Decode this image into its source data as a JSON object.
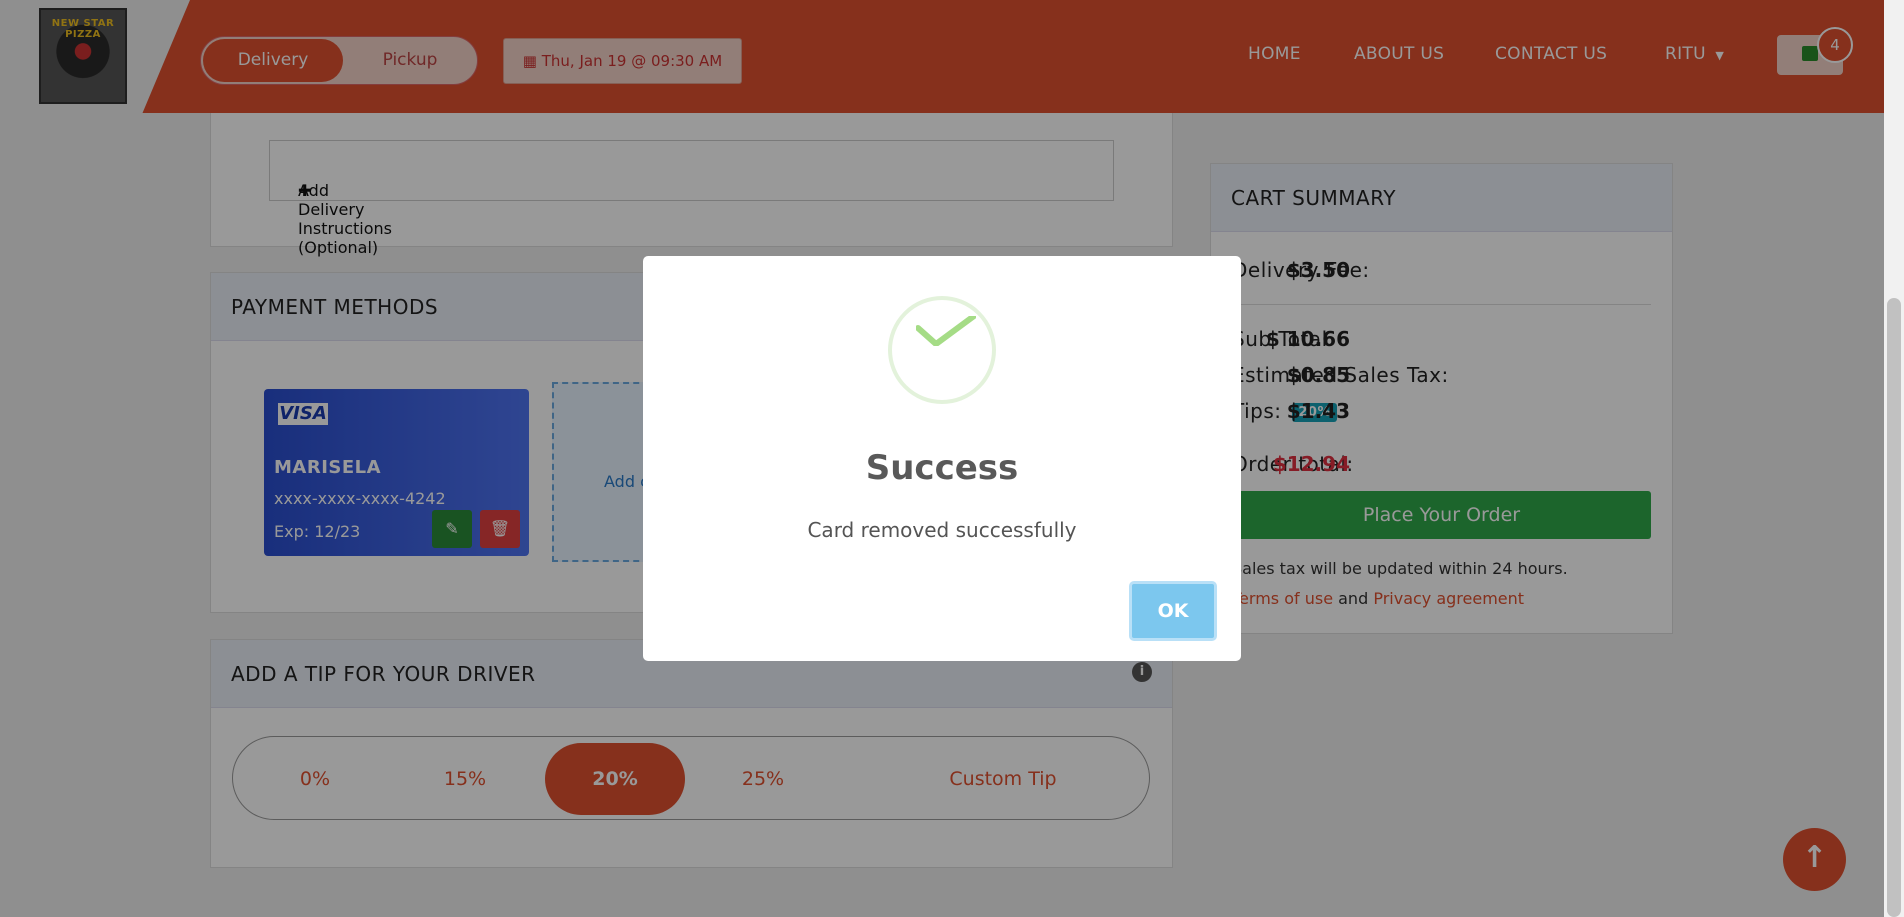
{
  "header": {
    "logo_text": "NEW STAR PIZZA",
    "order_type": {
      "active": "Delivery",
      "inactive": "Pickup"
    },
    "schedule": "Thu, Jan 19 @ 09:30 AM",
    "nav": [
      "HOME",
      "ABOUT US",
      "CONTACT US",
      "RITU"
    ],
    "cart_count": "4"
  },
  "delivery": {
    "instructions_label": "Add Delivery Instructions (Optional)",
    "plus": "✚"
  },
  "payment": {
    "title": "PAYMENT METHODS",
    "card": {
      "brand": "VISA",
      "name": "MARISELA",
      "number": "xxxx-xxxx-xxxx-4242",
      "expiry": "Exp: 12/23"
    },
    "add_card_label": "Add c"
  },
  "tip": {
    "title": "ADD A TIP FOR YOUR DRIVER",
    "options": [
      "0%",
      "15%",
      "20%",
      "25%",
      "Custom Tip"
    ],
    "selected": "20%"
  },
  "cart_summary": {
    "title": "CART SUMMARY",
    "delivery_fee_label": "Delivery Fee:",
    "delivery_fee": "$3.50",
    "subtotal_label": "Sub Total",
    "subtotal": "$ 10.66",
    "tax_label": "Estimated Sales Tax:",
    "tax": "$0.85",
    "tips_label": "Tips:",
    "tips_badge": "20%",
    "tips": "$1.43",
    "total_label": "Order total:",
    "total": "$12.94",
    "place_order": "Place Your Order",
    "note": "Sales tax will be updated within 24 hours.",
    "terms": "Terms of use",
    "and": "and",
    "privacy": "Privacy agreement"
  },
  "modal": {
    "title": "Success",
    "message": "Card removed successfully",
    "ok": "OK"
  },
  "colors": {
    "brand": "#e0502f",
    "success": "#2fa84a",
    "total": "#e03040"
  }
}
